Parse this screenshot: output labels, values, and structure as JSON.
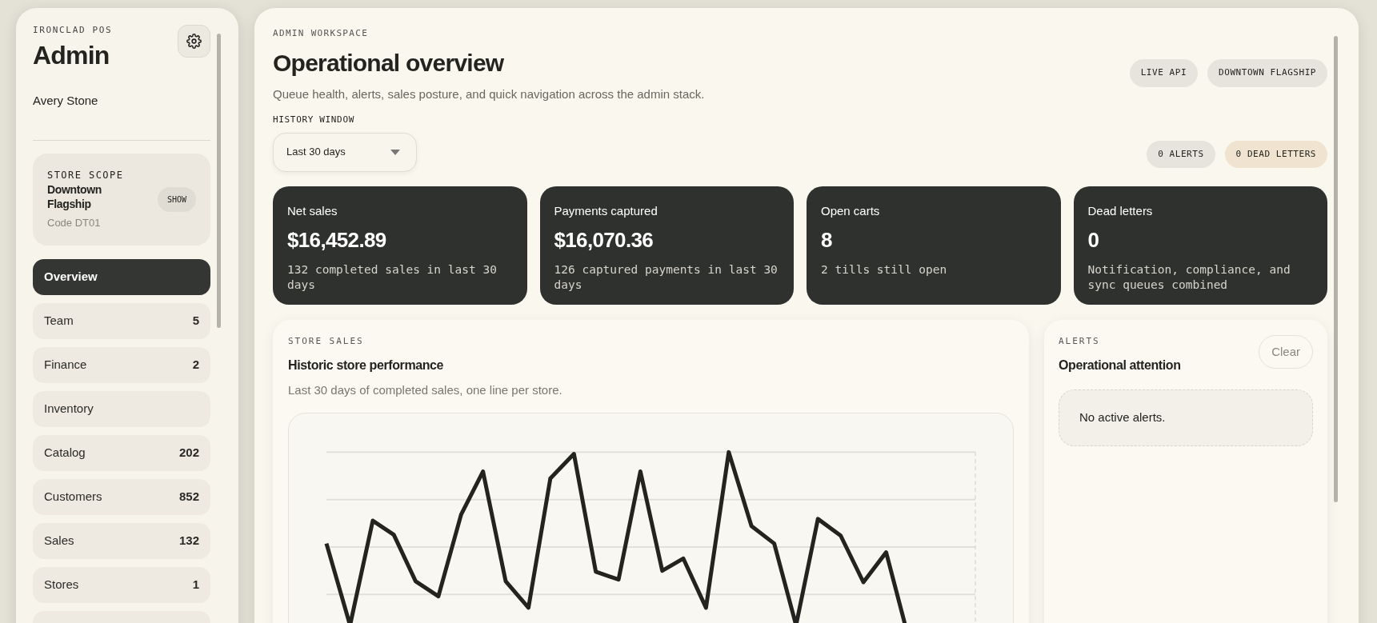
{
  "sidebar": {
    "brand": "IRONCLAD POS",
    "title": "Admin",
    "user": "Avery Stone",
    "store_scope": {
      "label": "STORE SCOPE",
      "name": "Downtown Flagship",
      "code": "Code DT01",
      "toggle": "SHOW"
    },
    "nav": [
      {
        "label": "Overview",
        "selected": true
      },
      {
        "label": "Team",
        "count": "5",
        "selected": false
      },
      {
        "label": "Finance",
        "count": "2",
        "selected": false
      },
      {
        "label": "Inventory",
        "selected": false
      },
      {
        "label": "Catalog",
        "count": "202",
        "selected": false
      },
      {
        "label": "Customers",
        "count": "852",
        "selected": false
      },
      {
        "label": "Sales",
        "count": "132",
        "selected": false
      },
      {
        "label": "Stores",
        "count": "1",
        "selected": false
      }
    ]
  },
  "main": {
    "eyebrow": "ADMIN WORKSPACE",
    "title": "Operational overview",
    "subtitle": "Queue health, alerts, sales posture, and quick navigation across the admin stack.",
    "badges": [
      "LIVE API",
      "DOWNTOWN FLAGSHIP"
    ],
    "history_window": {
      "label": "HISTORY WINDOW",
      "value": "Last 30 days"
    },
    "status_pills": [
      {
        "label": "0 ALERTS",
        "kind": "neutral"
      },
      {
        "label": "0 DEAD LETTERS",
        "kind": "warning"
      }
    ],
    "stats": [
      {
        "label": "Net sales",
        "value": "$16,452.89",
        "note": "132 completed sales in last 30 days"
      },
      {
        "label": "Payments captured",
        "value": "$16,070.36",
        "note": "126 captured payments in last 30 days"
      },
      {
        "label": "Open carts",
        "value": "8",
        "note": "2 tills still open"
      },
      {
        "label": "Dead letters",
        "value": "0",
        "note": "Notification, compliance, and sync queues combined"
      }
    ],
    "store_sales": {
      "eyebrow": "STORE SALES",
      "title": "Historic store performance",
      "subtitle": "Last 30 days of completed sales, one line per store."
    },
    "alerts": {
      "eyebrow": "ALERTS",
      "title": "Operational attention",
      "clear_button": "Clear",
      "empty": "No active alerts."
    }
  }
}
